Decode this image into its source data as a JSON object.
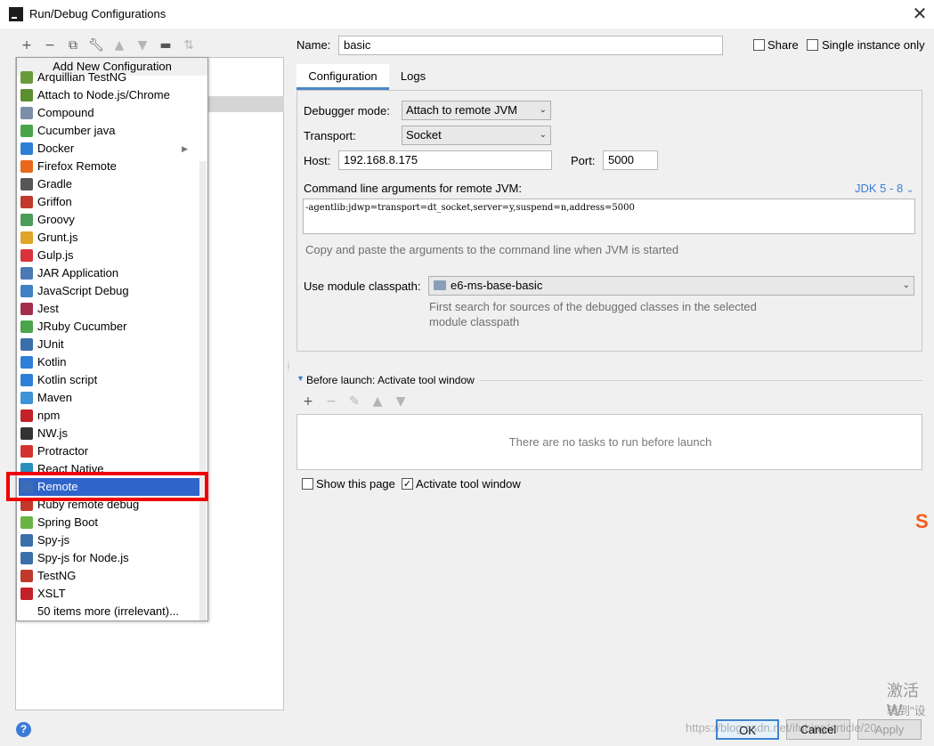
{
  "window": {
    "title": "Run/Debug Configurations"
  },
  "left_toolbar": {
    "icons": [
      "add-icon",
      "remove-icon",
      "copy-icon",
      "wrench-icon",
      "move-up-icon",
      "move-down-icon",
      "new-folder-icon",
      "sort-icon"
    ]
  },
  "popup": {
    "header": "Add New Configuration",
    "items": [
      {
        "label": "Arquillian TestNG",
        "icon": "arquillian",
        "color": "#6a9b3a"
      },
      {
        "label": "Attach to Node.js/Chrome",
        "icon": "nodejs",
        "color": "#5a8f2f"
      },
      {
        "label": "Compound",
        "icon": "compound",
        "color": "#7b8fa8"
      },
      {
        "label": "Cucumber java",
        "icon": "cucumber",
        "color": "#4aa54a"
      },
      {
        "label": "Docker",
        "icon": "docker",
        "color": "#2d7fd1"
      },
      {
        "label": "Firefox Remote",
        "icon": "firefox",
        "color": "#e8681c"
      },
      {
        "label": "Gradle",
        "icon": "gradle",
        "color": "#565656"
      },
      {
        "label": "Griffon",
        "icon": "griffon",
        "color": "#c0392b"
      },
      {
        "label": "Groovy",
        "icon": "groovy",
        "color": "#4a9d59"
      },
      {
        "label": "Grunt.js",
        "icon": "grunt",
        "color": "#e0a42a"
      },
      {
        "label": "Gulp.js",
        "icon": "gulp",
        "color": "#d9343b"
      },
      {
        "label": "JAR Application",
        "icon": "jar",
        "color": "#4a79b5"
      },
      {
        "label": "JavaScript Debug",
        "icon": "javascript-debug",
        "color": "#3f7fc4"
      },
      {
        "label": "Jest",
        "icon": "jest",
        "color": "#a22f4c"
      },
      {
        "label": "JRuby Cucumber",
        "icon": "jruby-cucumber",
        "color": "#4aa54a"
      },
      {
        "label": "JUnit",
        "icon": "junit",
        "color": "#3a6fa9"
      },
      {
        "label": "Kotlin",
        "icon": "kotlin",
        "color": "#2f7fd6"
      },
      {
        "label": "Kotlin script",
        "icon": "kotlin-script",
        "color": "#2f7fd6"
      },
      {
        "label": "Maven",
        "icon": "maven",
        "color": "#3d92d8"
      },
      {
        "label": "npm",
        "icon": "npm",
        "color": "#c12127"
      },
      {
        "label": "NW.js",
        "icon": "nwjs",
        "color": "#333333"
      },
      {
        "label": "Protractor",
        "icon": "protractor",
        "color": "#d2332f"
      },
      {
        "label": "React Native",
        "icon": "react",
        "color": "#2a8fbd"
      },
      {
        "label": "Remote",
        "icon": "remote",
        "color": "#3b6cb5"
      },
      {
        "label": "Ruby remote debug",
        "icon": "ruby-remote",
        "color": "#c0392b"
      },
      {
        "label": "Spring Boot",
        "icon": "spring-boot",
        "color": "#6bb344"
      },
      {
        "label": "Spy-js",
        "icon": "spyjs",
        "color": "#3a6fa9"
      },
      {
        "label": "Spy-js for Node.js",
        "icon": "spyjs-node",
        "color": "#3a6fa9"
      },
      {
        "label": "TestNG",
        "icon": "testng",
        "color": "#c0392b"
      },
      {
        "label": "XSLT",
        "icon": "xslt",
        "color": "#c12127"
      },
      {
        "label": "50 items more (irrelevant)...",
        "icon": "",
        "color": ""
      }
    ],
    "selected_label": "Remote"
  },
  "form": {
    "name_label": "Name:",
    "name_value": "basic",
    "share_label": "Share",
    "single_instance_label": "Single instance only",
    "tabs": [
      "Configuration",
      "Logs"
    ],
    "debugger_mode_label": "Debugger mode:",
    "debugger_mode_value": "Attach to remote JVM",
    "transport_label": "Transport:",
    "transport_value": "Socket",
    "host_label": "Host:",
    "host_value": "192.168.8.175",
    "port_label": "Port:",
    "port_value": "5000",
    "args_label": "Command line arguments for remote JVM:",
    "jdk_label": "JDK 5 - 8",
    "args_value": "-agentlib:jdwp=transport=dt_socket,server=y,suspend=n,address=5000",
    "args_hint": "Copy and paste the arguments to the command line when JVM is started",
    "module_label": "Use module classpath:",
    "module_value": "e6-ms-base-basic",
    "module_hint_1": "First search for sources of the debugged classes in the selected",
    "module_hint_2": "module classpath",
    "before_launch_label": "Before launch: Activate tool window",
    "no_tasks": "There are no tasks to run before launch",
    "show_page_label": "Show this page",
    "activate_tool_label": "Activate tool window"
  },
  "buttons": {
    "ok": "OK",
    "cancel": "Cancel",
    "apply": "Apply"
  },
  "overlay": {
    "watermark": "https://blog.csdn.net/ifubing/article/20",
    "activate_line1": "激活 W",
    "activate_line2": "转到\"设"
  },
  "colors": {
    "selection": "#2f65ca",
    "accent": "#4a88c7",
    "highlight_box": "#ee0000"
  }
}
